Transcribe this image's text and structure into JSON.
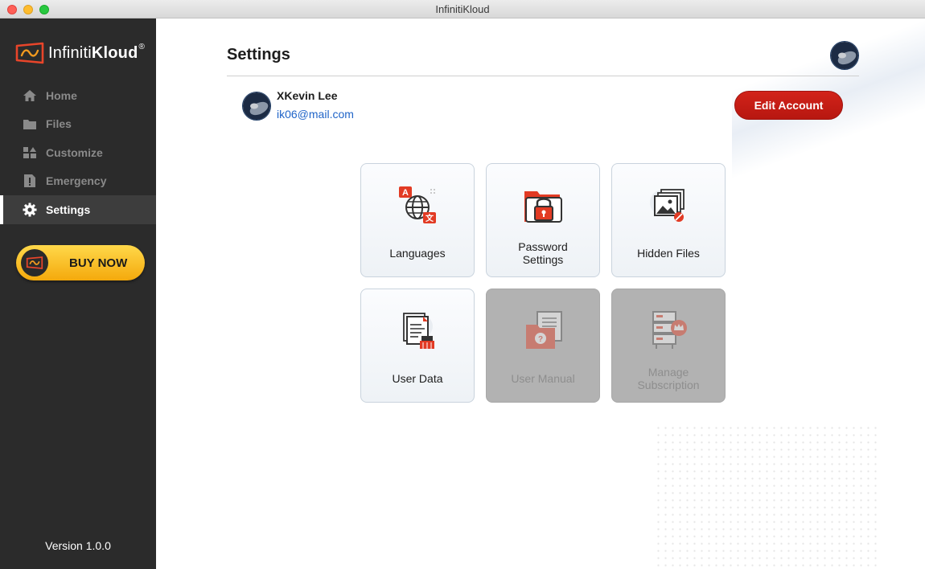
{
  "window": {
    "title": "InfinitiKloud"
  },
  "brand": {
    "name_light": "Infiniti",
    "name_bold": "Kloud",
    "reg": "®"
  },
  "sidebar": {
    "items": [
      {
        "label": "Home",
        "icon": "home-icon",
        "active": false
      },
      {
        "label": "Files",
        "icon": "folder-icon",
        "active": false
      },
      {
        "label": "Customize",
        "icon": "customize-icon",
        "active": false
      },
      {
        "label": "Emergency",
        "icon": "emergency-icon",
        "active": false
      },
      {
        "label": "Settings",
        "icon": "gear-icon",
        "active": true
      }
    ],
    "buy_label": "BUY NOW",
    "version": "Version 1.0.0"
  },
  "main": {
    "title": "Settings",
    "user": {
      "name": "XKevin Lee",
      "email": "ik06@mail.com"
    },
    "edit_button": "Edit Account",
    "tiles": [
      {
        "label": "Languages",
        "icon": "languages-icon",
        "enabled": true
      },
      {
        "label": "Password Settings",
        "icon": "password-lock-icon",
        "enabled": true
      },
      {
        "label": "Hidden Files",
        "icon": "hidden-image-icon",
        "enabled": true
      },
      {
        "label": "User Data",
        "icon": "user-data-icon",
        "enabled": true
      },
      {
        "label": "User Manual",
        "icon": "user-manual-icon",
        "enabled": false
      },
      {
        "label": "Manage Subscription",
        "icon": "subscription-icon",
        "enabled": false
      }
    ]
  },
  "colors": {
    "accent": "#c81e16",
    "sidebar_bg": "#2b2b2b",
    "link": "#1f64c8",
    "buy_button": "#f8c32a"
  }
}
